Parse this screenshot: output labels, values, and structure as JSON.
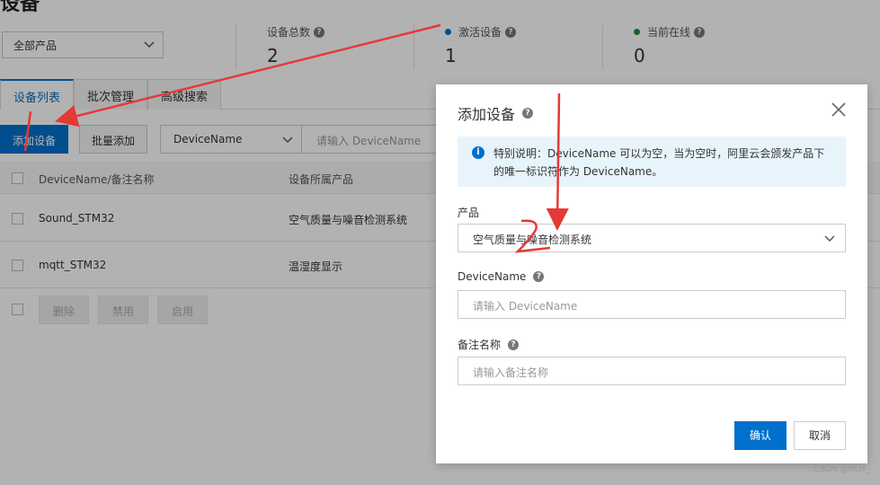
{
  "page": {
    "title": "设备"
  },
  "product_filter": {
    "value": "全部产品"
  },
  "stats": [
    {
      "label": "设备总数",
      "value": "2",
      "dot_color": ""
    },
    {
      "label": "激活设备",
      "value": "1",
      "dot_color": "#0070cc"
    },
    {
      "label": "当前在线",
      "value": "0",
      "dot_color": "#1e8e3e"
    }
  ],
  "tabs": [
    {
      "label": "设备列表",
      "active": true
    },
    {
      "label": "批次管理",
      "active": false
    },
    {
      "label": "高级搜索",
      "active": false
    }
  ],
  "toolbar": {
    "add_device": "添加设备",
    "batch_add": "批量添加",
    "search_field": "DeviceName",
    "search_placeholder": "请输入 DeviceName"
  },
  "table": {
    "headers": [
      "DeviceName/备注名称",
      "设备所属产品"
    ],
    "rows": [
      {
        "name": "Sound_STM32",
        "product": "空气质量与噪音检测系统"
      },
      {
        "name": "mqtt_STM32",
        "product": "温湿度显示"
      }
    ],
    "bulk_actions": [
      "删除",
      "禁用",
      "启用"
    ]
  },
  "modal": {
    "title": "添加设备",
    "info_text": "特别说明：DeviceName 可以为空，当为空时，阿里云会颁发产品下的唯一标识符作为 DeviceName。",
    "product_label": "产品",
    "product_value": "空气质量与噪音检测系统",
    "devicename_label": "DeviceName",
    "devicename_placeholder": "请输入 DeviceName",
    "remark_label": "备注名称",
    "remark_placeholder": "请输入备注名称",
    "confirm": "确认",
    "cancel": "取消"
  },
  "watermark": "CSDN @MLH_",
  "colors": {
    "primary": "#0070cc",
    "annotation": "#e53935"
  }
}
